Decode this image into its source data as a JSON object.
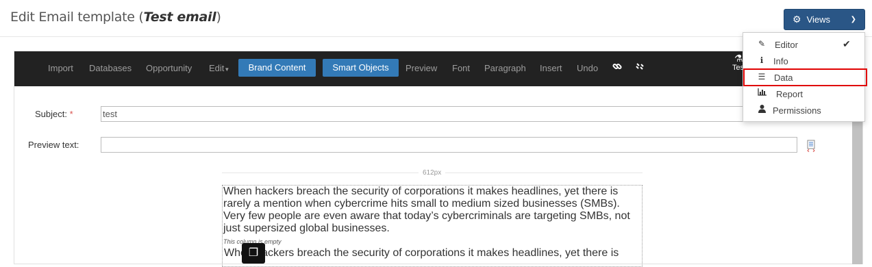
{
  "header": {
    "title_prefix": "Edit Email template (",
    "template_name": "Test email",
    "title_suffix": ")",
    "views_label": "Views"
  },
  "toolbar": {
    "items": [
      "Import",
      "Databases",
      "Opportunity",
      "Edit"
    ],
    "brand_content": "Brand Content",
    "smart_objects": "Smart Objects",
    "items2": [
      "Preview",
      "Font",
      "Paragraph",
      "Insert",
      "Undo"
    ],
    "test_label": "Test"
  },
  "form": {
    "subject_label": "Subject:",
    "subject_required": "*",
    "subject_value": "test",
    "preview_label": "Preview text:",
    "preview_value": ""
  },
  "canvas": {
    "width_label": "612px",
    "paragraph": "When hackers breach the security of corporations it makes headlines, yet there is rarely a mention when cybercrime hits small to medium sized businesses (SMBs). Very few people are even aware that today’s cybercriminals are targeting SMBs, not just supersized global businesses.",
    "empty_note": "This column is empty",
    "paragraph2": "When hackers breach the security of corporations it makes headlines, yet there is"
  },
  "views_menu": {
    "items": [
      {
        "label": "Editor",
        "icon": "edit-icon",
        "checked": true
      },
      {
        "label": "Info",
        "icon": "info-icon",
        "checked": false
      },
      {
        "label": "Data",
        "icon": "database-icon",
        "checked": false
      },
      {
        "label": "Report",
        "icon": "bar-chart-icon",
        "checked": false
      },
      {
        "label": "Permissions",
        "icon": "user-icon",
        "checked": false
      }
    ]
  },
  "colors": {
    "toolbar_bg": "#222222",
    "primary": "#337ab7",
    "views_button": "#2a5686",
    "highlight": "#e00000"
  }
}
